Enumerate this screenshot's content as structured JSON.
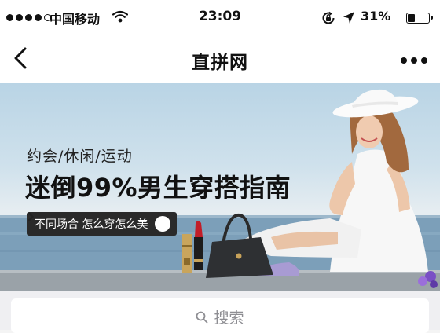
{
  "status_bar": {
    "carrier": "中国移动",
    "time": "23:09",
    "battery_percent": "31%",
    "battery_level": 0.31,
    "signal_bars_filled": 4,
    "signal_bars_total": 5,
    "icons": [
      "wifi-icon",
      "orientation-lock-icon",
      "location-arrow-icon",
      "battery-icon"
    ]
  },
  "nav": {
    "title": "直拼网",
    "back_icon": "chevron-left-icon",
    "more_icon": "more-dots-icon"
  },
  "banner": {
    "tagline": "约会/休闲/运动",
    "headline": "迷倒99%男生穿搭指南",
    "cta_label": "不同场合 怎么穿怎么美",
    "cta_icon": "chevron-right-circle-icon"
  },
  "search": {
    "placeholder": "搜索",
    "icon": "search-icon"
  },
  "colors": {
    "bar_background": "#ffffff",
    "cta_background": "#2a2a2a",
    "search_area_background": "#efeff2",
    "placeholder_text": "#8e8e93"
  }
}
